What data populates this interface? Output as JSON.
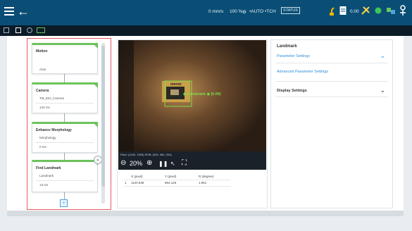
{
  "topbar": {
    "speed": "0 mm/s",
    "percent": "100 %",
    "mode_auto": "•AUTO",
    "mode_tch": "•TCH",
    "status_box": "STATUS",
    "counter": "0.00",
    "colors": {
      "bar": "#0a4e76",
      "accent_green": "#6cc35b",
      "flow_border": "#e85862",
      "link_blue": "#2f8fd8"
    }
  },
  "flow": {
    "blocks": [
      {
        "title": "Motion",
        "line1": "",
        "line2": "Auto"
      },
      {
        "title": "Camera",
        "line1": "TM_EIH_Camera",
        "line2": "143 ms"
      },
      {
        "title": "Enhance Morphology",
        "line1": "Morphology",
        "line2": "0 ms"
      },
      {
        "title": "Find Landmark",
        "line1": "Landmark",
        "line2": "13 ms"
      }
    ]
  },
  "camera": {
    "brand_text": "omron",
    "overlay_label": "◆ Landmark ◆ (0.00)",
    "info_line": "Pixel: (1440, 1905)  RGB: (034, 060, 034)",
    "zoom": "20%"
  },
  "result_table": {
    "headers": [
      "X (pixel)",
      "Y (pixel)",
      "R (degree)"
    ],
    "rows": [
      {
        "index": "1",
        "x": "1120.939",
        "y": "864.126",
        "r": "1.951"
      }
    ]
  },
  "right_panel": {
    "title": "Landmark",
    "parameter_settings": "Parameter Settings",
    "advanced_settings": "Advanced Parameter Settings",
    "display_settings": "Display Settings"
  }
}
